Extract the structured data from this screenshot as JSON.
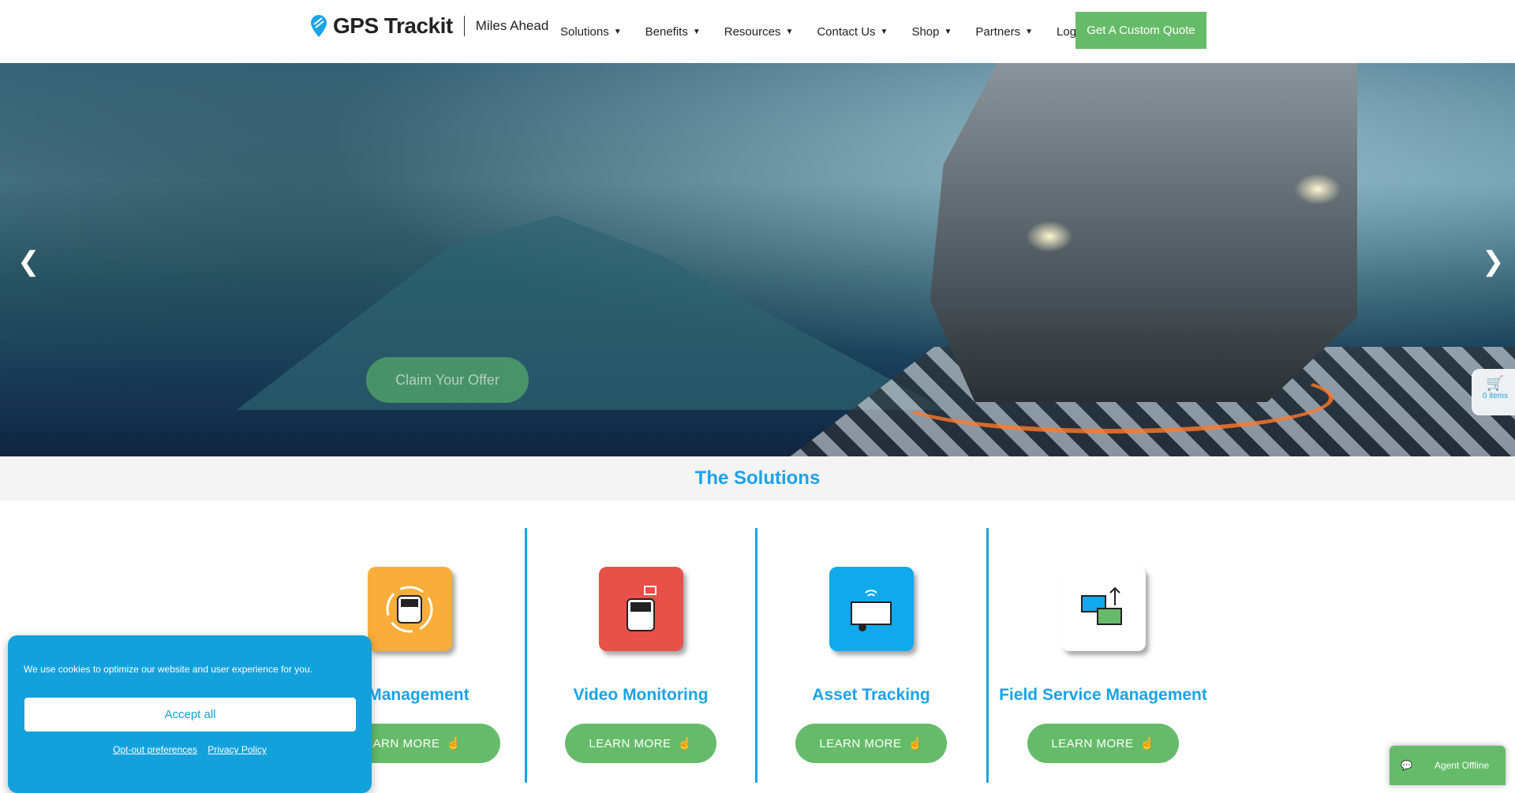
{
  "header": {
    "logo_text": "GPS Trackit",
    "tagline": "Miles Ahead",
    "nav": [
      {
        "label": "Solutions",
        "dropdown": true
      },
      {
        "label": "Benefits",
        "dropdown": true
      },
      {
        "label": "Resources",
        "dropdown": true
      },
      {
        "label": "Contact Us",
        "dropdown": true
      },
      {
        "label": "Shop",
        "dropdown": true
      },
      {
        "label": "Partners",
        "dropdown": true
      },
      {
        "label": "Login",
        "dropdown": false
      }
    ],
    "cta": "Get A Custom Quote"
  },
  "hero": {
    "button": "Claim Your Offer",
    "prev_icon": "chevron-left-icon",
    "next_icon": "chevron-right-icon"
  },
  "cart": {
    "count_label": "0 items"
  },
  "solutions": {
    "title": "The Solutions",
    "items": [
      {
        "title": "Fleet Management",
        "visible_title": "t Management",
        "button": "LEARN MORE",
        "color": "#f9ae3b"
      },
      {
        "title": "Video Monitoring",
        "button": "LEARN MORE",
        "color": "#e8504a"
      },
      {
        "title": "Asset Tracking",
        "button": "LEARN MORE",
        "color": "#12a9ec"
      },
      {
        "title": "Field Service Management",
        "button": "LEARN MORE",
        "color": "#ffffff"
      }
    ]
  },
  "cookie": {
    "message": "We use cookies to optimize our website and user experience for you.",
    "accept": "Accept all",
    "optout": "Opt-out preferences",
    "privacy": "Privacy Policy"
  },
  "chat": {
    "label": "Agent Offline"
  },
  "colors": {
    "accent": "#1aa3e8",
    "green": "#66bb6a"
  }
}
